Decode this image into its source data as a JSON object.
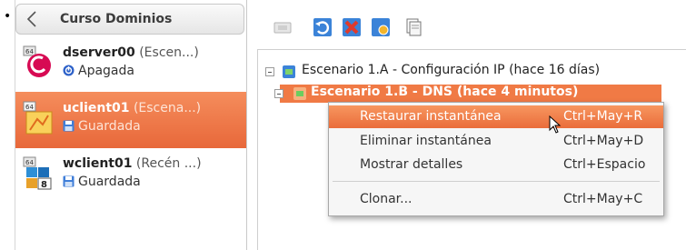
{
  "bullet": "•",
  "left_panel": {
    "group_title": "Curso Dominios",
    "vms": [
      {
        "name": "dserver00",
        "suffix": " (Escen...)",
        "state": "Apagada",
        "state_icon": "power-off-icon",
        "os_icon": "debian-icon"
      },
      {
        "name": "uclient01",
        "suffix": " (Escena...)",
        "state": "Guardada",
        "state_icon": "saved-state-icon",
        "os_icon": "ubuntu-icon"
      },
      {
        "name": "wclient01",
        "suffix": " (Recén ...)",
        "state": "Guardada",
        "state_icon": "saved-state-icon",
        "os_icon": "windows8-icon"
      }
    ]
  },
  "snapshot_tree": {
    "nodes": [
      {
        "label": "Escenario 1.A - Configuración IP (hace 16 días)"
      },
      {
        "label": "Escenario 1.B - DNS (hace 4 minutos)"
      }
    ]
  },
  "context_menu": {
    "items": [
      {
        "label": "Restaurar instantánea",
        "shortcut": "Ctrl+May+R"
      },
      {
        "label": "Eliminar instantánea",
        "shortcut": "Ctrl+May+D"
      },
      {
        "label": "Mostrar detalles",
        "shortcut": "Ctrl+Espacio"
      },
      {
        "label": "Clonar...",
        "shortcut": "Ctrl+May+C"
      }
    ]
  },
  "colors": {
    "accent": "#ee7240",
    "selection_text": "#ffffff"
  }
}
